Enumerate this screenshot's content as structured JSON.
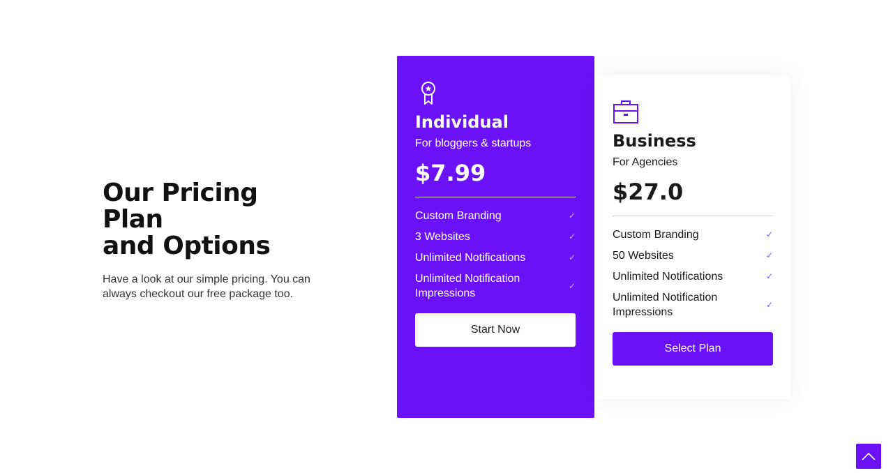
{
  "intro": {
    "title_line1": "Our Pricing Plan",
    "title_line2": "and Options",
    "description": "Have a look at our simple pricing. You can always checkout our free package too."
  },
  "plans": [
    {
      "icon": "award-ribbon-icon",
      "name": "Individual",
      "subtitle": "For bloggers & startups",
      "price": "$7.99",
      "features": [
        "Custom Branding",
        "3 Websites",
        "Unlimited Notifications",
        "Unlimited Notification Impressions"
      ],
      "button_label": "Start Now"
    },
    {
      "icon": "briefcase-icon",
      "name": "Business",
      "subtitle": "For Agencies",
      "price": "$27.0",
      "features": [
        "Custom Branding",
        "50 Websites",
        "Unlimited Notifications",
        "Unlimited Notification Impressions"
      ],
      "button_label": "Select Plan"
    }
  ],
  "check_mark": "✓",
  "scroll_top_icon": "chevron-up-icon",
  "colors": {
    "accent": "#6a11f8",
    "text": "#1a1a1a"
  }
}
